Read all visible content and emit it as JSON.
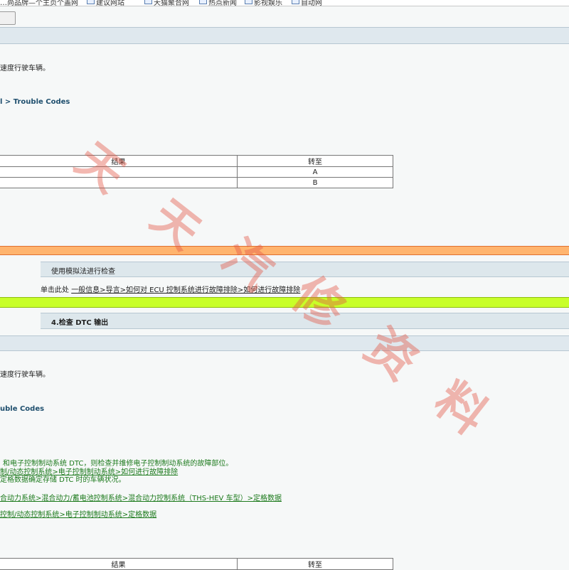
{
  "toolbar": {
    "items": [
      {
        "label": "…尚品牌—个主页个盖网",
        "icon": "page-icon"
      },
      {
        "label": "建议网站",
        "icon": "page-icon"
      },
      {
        "label": "天猫聚合网",
        "icon": "page-icon"
      },
      {
        "label": "热点新闻",
        "icon": "page-icon"
      },
      {
        "label": "影视娱乐",
        "icon": "page-icon"
      },
      {
        "label": "自动网",
        "icon": "page-icon"
      }
    ]
  },
  "section1": {
    "drive_text": "速度行驶车辆。",
    "breadcrumb": "l > Trouble Codes",
    "table": {
      "headers": [
        "结果",
        "转至"
      ],
      "rows": [
        [
          "",
          "A"
        ],
        [
          "",
          "B"
        ]
      ]
    }
  },
  "step_simulation": {
    "title": "使用模拟法进行检查",
    "click_text": "单击此处",
    "link_text": "一般信息>导言>如何对 ECU 控制系统进行故障排除>如何进行故障排除"
  },
  "step4": {
    "title": "4.检查 DTC 输出"
  },
  "section2": {
    "drive_text": "速度行驶车辆。",
    "breadcrumb": "uble Codes",
    "note_line1": "和电子控制制动系统 DTC，则检查并维修电子控制制动系统的故障部位。",
    "link1": "制/动态控制系统>电子控制制动系统>如何进行故障排除",
    "note_line2": "定格数据确定存储 DTC 时的车辆状况。",
    "link2": "合动力系统>混合动力/蓄电池控制系统>混合动力控制系统（THS-HEV 车型）>定格数据",
    "link3": "控制/动态控制系统>电子控制制动系统>定格数据",
    "table": {
      "headers": [
        "结果",
        "转至"
      ]
    }
  },
  "watermark": "天天汽修资料",
  "colors": {
    "orange_band": "#ffb46e",
    "lime_band": "#c8ff28",
    "header_band": "#dfe8ee",
    "green_text": "#1c7a1c",
    "watermark": "#e25546"
  }
}
